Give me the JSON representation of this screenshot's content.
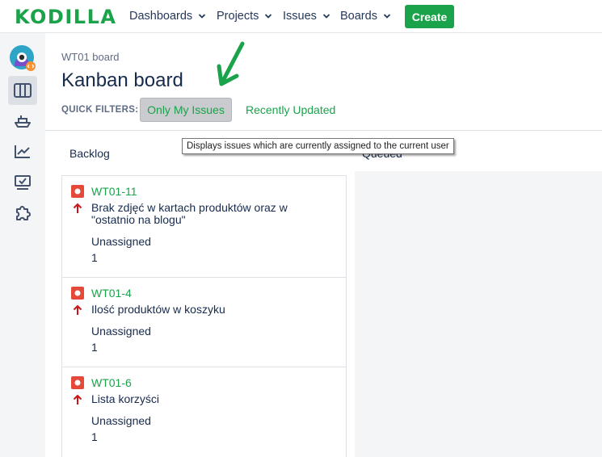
{
  "app": {
    "logo_text": "KODILLA",
    "nav": [
      {
        "label": "Dashboards"
      },
      {
        "label": "Projects"
      },
      {
        "label": "Issues"
      },
      {
        "label": "Boards"
      }
    ],
    "create_label": "Create"
  },
  "page": {
    "breadcrumb": "WT01 board",
    "title": "Kanban board",
    "quick_filters_label": "QUICK FILTERS:",
    "quick_filters": [
      {
        "label": "Only My Issues",
        "active": true
      },
      {
        "label": "Recently Updated",
        "active": false
      }
    ],
    "tooltip": "Displays issues which are currently assigned to the current user"
  },
  "columns": [
    {
      "name": "Backlog"
    },
    {
      "name": "Queued"
    }
  ],
  "cards": [
    {
      "key": "WT01-11",
      "summary_line1": "Brak zdjęć w kartach produktów oraz w",
      "summary_line2": "\"ostatnio na blogu\"",
      "assignee": "Unassigned",
      "points": "1"
    },
    {
      "key": "WT01-4",
      "summary_line1": "Ilość produktów w koszyku",
      "summary_line2": "",
      "assignee": "Unassigned",
      "points": "1"
    },
    {
      "key": "WT01-6",
      "summary_line1": "Lista korzyści",
      "summary_line2": "",
      "assignee": "Unassigned",
      "points": "1"
    }
  ],
  "colors": {
    "brand_green": "#1aa34a",
    "bug_red": "#e5493a",
    "priority_red": "#cd1317"
  }
}
